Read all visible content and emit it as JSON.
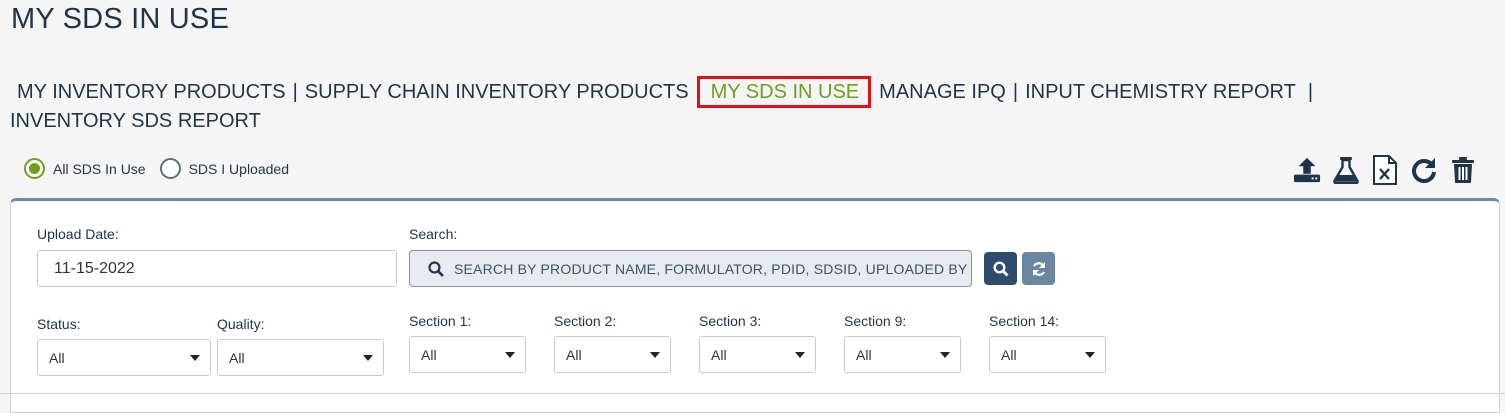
{
  "page": {
    "title": "MY SDS IN USE"
  },
  "nav": {
    "items": [
      "MY INVENTORY PRODUCTS",
      "SUPPLY CHAIN INVENTORY PRODUCTS",
      "MY SDS IN USE",
      "MANAGE IPQ",
      "INPUT CHEMISTRY REPORT",
      "INVENTORY SDS REPORT"
    ],
    "separator": "|",
    "active": "MY SDS IN USE"
  },
  "radios": {
    "all_sds": "All SDS In Use",
    "uploaded": "SDS I Uploaded",
    "selected": "All SDS In Use"
  },
  "toolbar": {
    "icons": [
      "upload-icon",
      "flask-icon",
      "excel-file-icon",
      "refresh-icon",
      "trash-icon"
    ]
  },
  "filters": {
    "upload_date_label": "Upload Date:",
    "upload_date_value": "11-15-2022",
    "search_label": "Search:",
    "search_placeholder": "SEARCH BY PRODUCT NAME, FORMULATOR, PDID, SDSID, UPLOADED BY",
    "status_label": "Status:",
    "status_value": "All",
    "quality_label": "Quality:",
    "quality_value": "All",
    "section1_label": "Section 1:",
    "section1_value": "All",
    "section2_label": "Section 2:",
    "section2_value": "All",
    "section3_label": "Section 3:",
    "section3_value": "All",
    "section9_label": "Section 9:",
    "section9_value": "All",
    "section14_label": "Section 14:",
    "section14_value": "All"
  },
  "colors": {
    "accent_green": "#6f9e1f",
    "navy": "#1f3349",
    "highlight_red": "#e0101a",
    "button_dark": "#2f4c6e",
    "button_light": "#6a879f"
  }
}
